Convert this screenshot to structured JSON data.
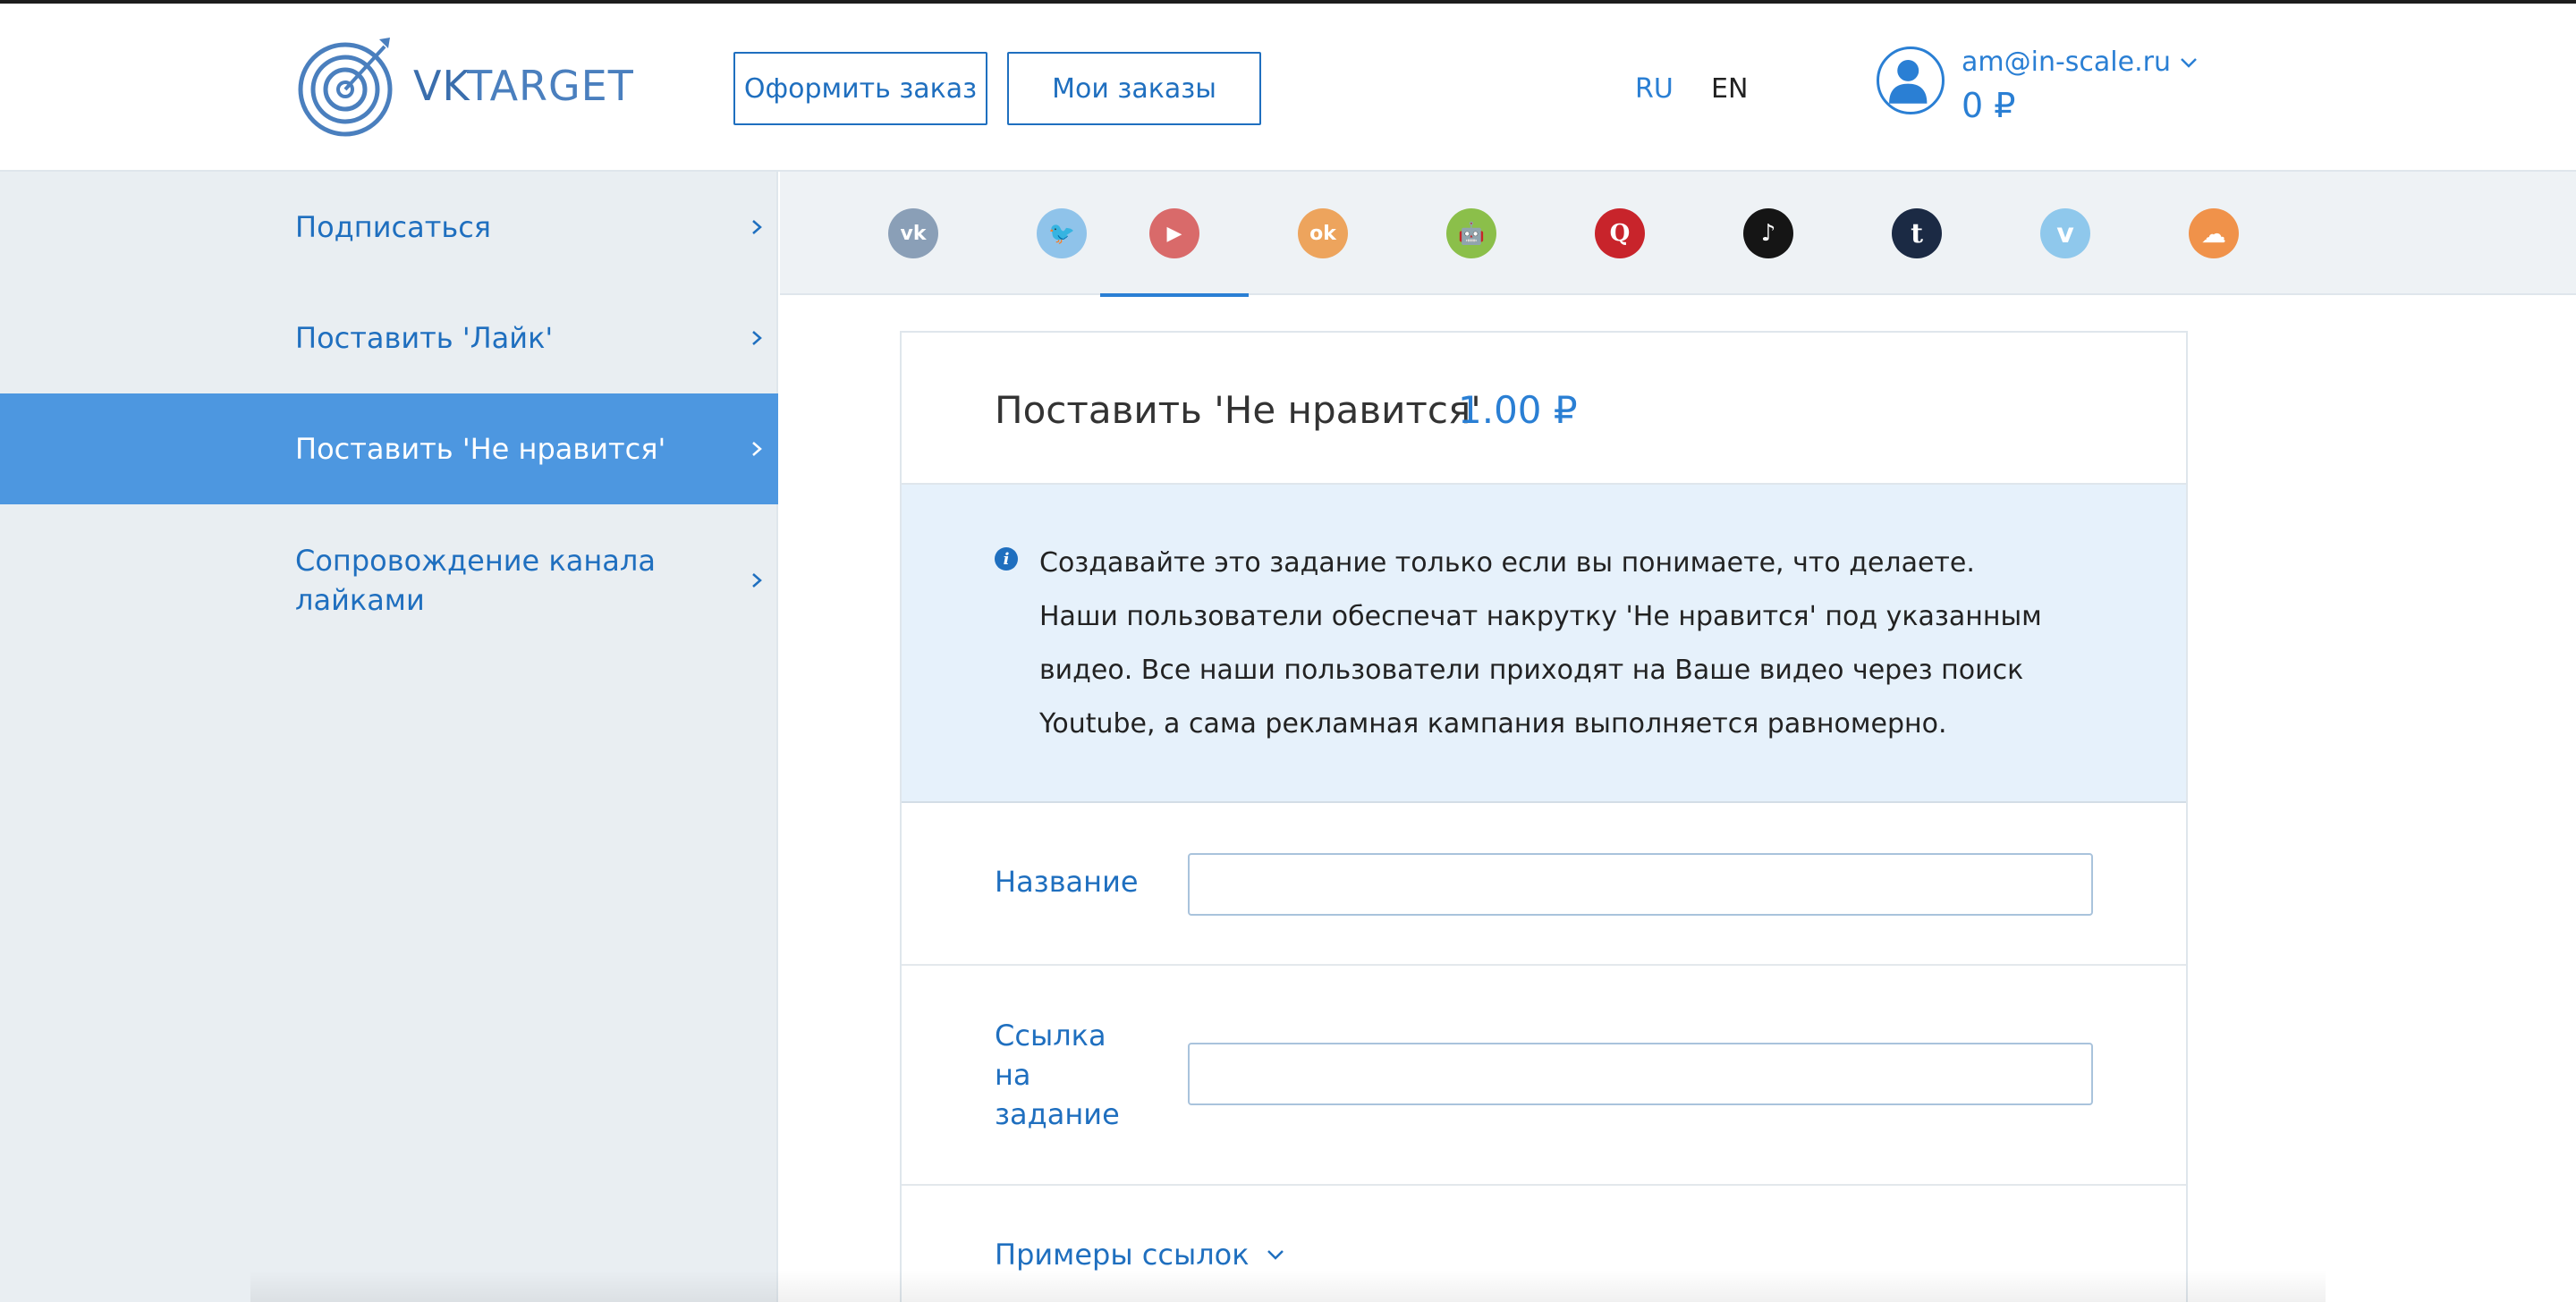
{
  "brand": {
    "name_part1": "VK",
    "name_part2": "TARGET"
  },
  "header": {
    "order_button": "Оформить заказ",
    "my_orders_button": "Мои заказы",
    "lang_ru": "RU",
    "lang_en": "EN",
    "user_email": "am@in-scale.ru",
    "balance": "0 ₽"
  },
  "sidebar": {
    "items": [
      {
        "label": "Подписаться",
        "active": false
      },
      {
        "label": "Поставить 'Лайк'",
        "active": false
      },
      {
        "label": "Поставить 'Не нравится'",
        "active": true
      },
      {
        "label": "Сопровождение канала лайками",
        "active": false
      }
    ]
  },
  "social_tabs": [
    {
      "icon": "vk-icon",
      "glyph": "vk",
      "color": "#8a9fb7"
    },
    {
      "icon": "twitter-icon",
      "glyph": "🐦",
      "color": "#8fc3ea"
    },
    {
      "icon": "youtube-icon",
      "glyph": "▶",
      "color": "#d96a6a",
      "active": true
    },
    {
      "icon": "odnoklassniki-icon",
      "glyph": "ok",
      "color": "#eda45d"
    },
    {
      "icon": "android-icon",
      "glyph": "🤖",
      "color": "#8bbf4a"
    },
    {
      "icon": "quora-icon",
      "glyph": "Q",
      "color": "#c8242b"
    },
    {
      "icon": "tiktok-icon",
      "glyph": "♪",
      "color": "#151515"
    },
    {
      "icon": "tumblr-icon",
      "glyph": "t",
      "color": "#1b2a44"
    },
    {
      "icon": "vimeo-icon",
      "glyph": "v",
      "color": "#8fc8ec"
    },
    {
      "icon": "soundcloud-icon",
      "glyph": "☁",
      "color": "#f0924a"
    }
  ],
  "task": {
    "title": "Поставить 'Не нравится'",
    "price": "1.00 ₽",
    "info_icon": "i",
    "info_text": "Создавайте это задание только если вы понимаете, что делаете. Наши пользователи обеспечат накрутку 'Не нравится' под указанным видео. Все наши пользователи приходят на Ваше видео через поиск Youtube, а сама рекламная кампания выполняется равномерно.",
    "fields": {
      "name_label": "Название",
      "name_value": "",
      "link_label": "Ссылка на задание",
      "link_value": ""
    },
    "examples_label": "Примеры ссылок"
  },
  "colors": {
    "accent": "#1f6fbf",
    "sidebar_active": "#4d97e0",
    "info_bg": "#e6f1fb"
  }
}
